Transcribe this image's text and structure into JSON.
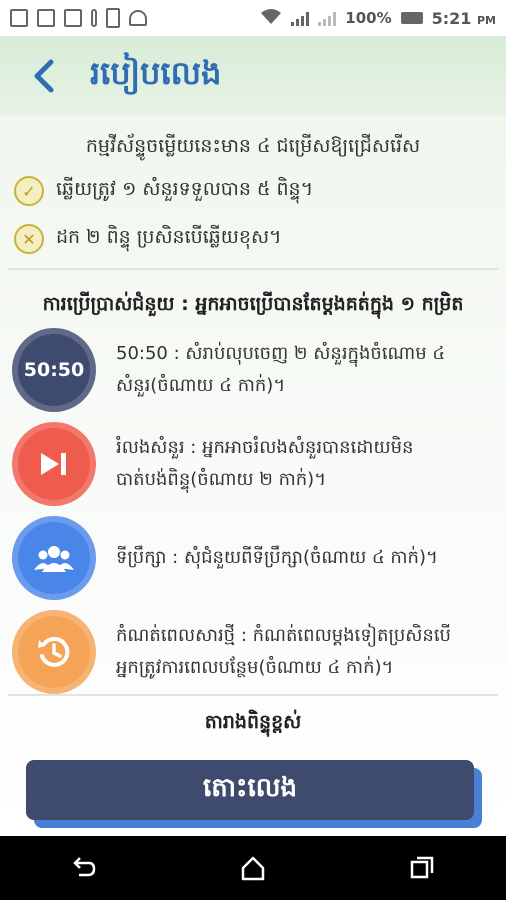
{
  "status_bar": {
    "battery": "100%",
    "time": "5:21",
    "ampm": "PM"
  },
  "header": {
    "title": "របៀបលេង"
  },
  "rules": {
    "heading": "កម្មវីស័ន្ទូចម្លើយនេះមាន ៤ ជម្រើសឱ្យជ្រើសរើស",
    "correct": "ឆ្លើយត្រូវ ១ សំនួរទទួលបាន ៥ ពិន្ទុ។",
    "wrong": "ដក ២ ពិន្ទុ ប្រសិនបើឆ្លើយខុស។"
  },
  "help": {
    "heading": "ការប្រើប្រាស់ជំនួយ : អ្នកអាចប្រើបានតែម្តងគត់ក្នុង ១ កម្រិត",
    "items": [
      {
        "icon_label": "50:50",
        "line1": "50:50 : សំរាប់លុបចេញ ២ សំនួរក្នុងចំណោម ៤",
        "line2": "សំនួរ(ចំណាយ ៤ កាក់)។",
        "color": "#3e4a6e"
      },
      {
        "line1": "រំលងសំនួរ : អ្នកអាចរំលងសំនួរបានដោយមិន",
        "line2": "បាត់បង់ពិន្ទុ(ចំណាយ ២ កាក់)។",
        "color": "#ef5b4c"
      },
      {
        "line1": "ទីប្រឹក្សា : សុំជំនួយពីទីប្រឹក្សា(ចំណាយ ៤ កាក់)។",
        "line2": "",
        "color": "#4a86e8"
      },
      {
        "line1": "កំណត់ពេលសារថ្មី : កំណត់ពេលម្តងទៀតប្រសិនបើ",
        "line2": "អ្នកត្រូវការពេលបន្ថែម(ចំណាយ ៤ កាក់)។",
        "color": "#f5a356"
      }
    ]
  },
  "highscore_label": "តារាងពិន្ទុខ្ពស់",
  "play_label": "តោះលេង",
  "colors": {
    "accent": "#2f6db3",
    "button": "#3e4a6e",
    "button_shadow": "#4a7fd6"
  }
}
